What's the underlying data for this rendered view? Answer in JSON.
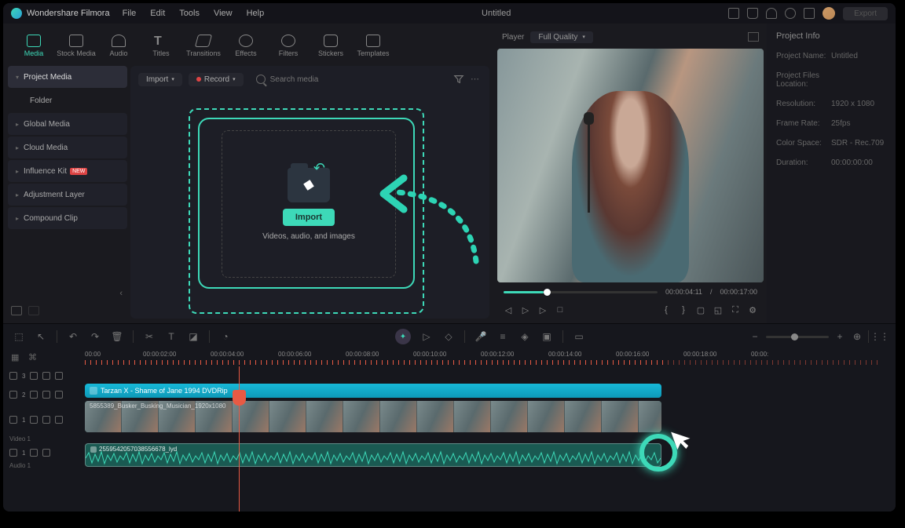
{
  "app": {
    "name": "Wondershare Filmora",
    "document_title": "Untitled",
    "export_label": "Export"
  },
  "menu": [
    "File",
    "Edit",
    "Tools",
    "View",
    "Help"
  ],
  "media_tabs": [
    {
      "label": "Media",
      "active": true
    },
    {
      "label": "Stock Media"
    },
    {
      "label": "Audio"
    },
    {
      "label": "Titles"
    },
    {
      "label": "Transitions"
    },
    {
      "label": "Effects"
    },
    {
      "label": "Filters"
    },
    {
      "label": "Stickers"
    },
    {
      "label": "Templates"
    }
  ],
  "sidebar": {
    "items": [
      {
        "label": "Project Media",
        "active": true
      },
      {
        "label": "Folder",
        "sub": true
      },
      {
        "label": "Global Media"
      },
      {
        "label": "Cloud Media"
      },
      {
        "label": "Influence Kit",
        "badge": "NEW"
      },
      {
        "label": "Adjustment Layer"
      },
      {
        "label": "Compound Clip"
      }
    ]
  },
  "panel_toolbar": {
    "import": "Import",
    "record": "Record",
    "search_placeholder": "Search media"
  },
  "drop_zone": {
    "import_btn": "Import",
    "subtitle": "Videos, audio, and images"
  },
  "preview": {
    "player_label": "Player",
    "quality": "Full Quality",
    "current_time": "00:00:04:11",
    "total_time": "00:00:17:00"
  },
  "info": {
    "title": "Project Info",
    "rows": [
      {
        "label": "Project Name:",
        "value": "Untitled"
      },
      {
        "label": "Project Files Location:",
        "value": ""
      },
      {
        "label": "Resolution:",
        "value": "1920 x 1080"
      },
      {
        "label": "Frame Rate:",
        "value": "25fps"
      },
      {
        "label": "Color Space:",
        "value": "SDR - Rec.709"
      },
      {
        "label": "Duration:",
        "value": "00:00:00:00"
      }
    ]
  },
  "timeline": {
    "ruler": [
      "00:00",
      "00:00:02:00",
      "00:00:04:00",
      "00:00:06:00",
      "00:00:08:00",
      "00:00:10:00",
      "00:00:12:00",
      "00:00:14:00",
      "00:00:16:00",
      "00:00:18:00",
      "00:00:"
    ],
    "title_clip": "Tarzan X - Shame of Jane 1994 DVDRip",
    "video_clip": "5855389_Busker_Busking_Musician_1920x1080",
    "audio_clip": "2559542057038556678_lyd",
    "track_labels": {
      "video": "Video 1",
      "audio": "Audio 1"
    },
    "track3": "3",
    "track2": "2",
    "track1": "1",
    "audio1": "1",
    "body_separator": "/"
  }
}
